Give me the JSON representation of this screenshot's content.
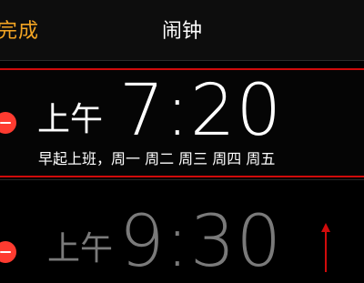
{
  "nav": {
    "done_label": "完成",
    "title": "闹钟"
  },
  "alarms": [
    {
      "period": "上午",
      "time": "7:20",
      "label": "早起上班，周一 周二 周三 周四 周五",
      "enabled": true
    },
    {
      "period": "上午",
      "time": "9:30",
      "enabled": false
    }
  ],
  "colors": {
    "accent": "#f5a623",
    "delete": "#ff3b30",
    "highlight": "#d10b0b",
    "disabled_text": "#7a7a7a"
  }
}
